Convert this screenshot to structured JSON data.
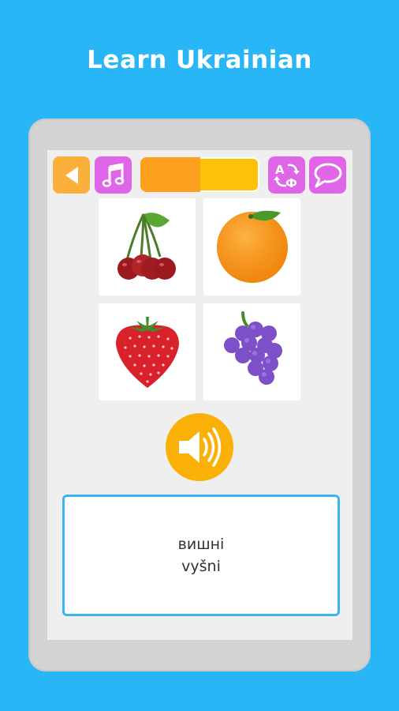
{
  "header": {
    "title": "Learn Ukrainian"
  },
  "toolbar": {
    "back_icon": "back-triangle-icon",
    "music_icon": "music-note-icon",
    "translate_icon": "translate-icon",
    "chat_icon": "speech-bubble-icon",
    "progress": 0.5
  },
  "cards": [
    {
      "name": "cherries",
      "icon": "cherries-icon"
    },
    {
      "name": "orange",
      "icon": "orange-icon"
    },
    {
      "name": "strawberry",
      "icon": "strawberry-icon"
    },
    {
      "name": "grapes",
      "icon": "grapes-icon"
    }
  ],
  "speaker": {
    "icon": "speaker-icon"
  },
  "answer": {
    "native": "вишні",
    "transliteration": "vyšni"
  },
  "colors": {
    "background": "#29b6f6",
    "accent_orange": "#fbb03b",
    "accent_purple": "#e066e8",
    "answer_border": "#3cb4f2"
  },
  "translate_glyphs": {
    "top": "A",
    "bottom": "Ф"
  }
}
